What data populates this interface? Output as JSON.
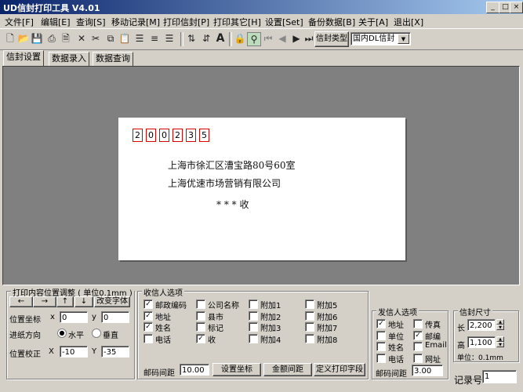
{
  "window": {
    "title": "UD信封打印工具 V4.01"
  },
  "menu": [
    "文件[F]",
    "编辑[E]",
    "查询[S]",
    "移动记录[M]",
    "打印信封[P]",
    "打印其它[H]",
    "设置[Set]",
    "备份数据[B]",
    "关于[A]",
    "退出[X]"
  ],
  "toolbar": {
    "type_button": "信封类型",
    "type_value": "国内DL信封"
  },
  "tabs": [
    "信封设置",
    "数据录入",
    "数据查询"
  ],
  "envelope": {
    "zip": [
      "2",
      "0",
      "0",
      "2",
      "3",
      "5"
    ],
    "address": "上海市徐汇区漕宝路80号60室",
    "company": "上海优速市场营销有限公司",
    "recipient": "* * *   收"
  },
  "position_panel": {
    "title": "打印内容位置调整 ( 单位0.1mm )",
    "arrows": [
      "←",
      "→",
      "↑",
      "↓"
    ],
    "change_font": "改变字体",
    "coord_label": "位置坐标",
    "x_label": "x",
    "x_value": "0",
    "y_label": "y",
    "y_value": "0",
    "direction_label": "进纸方向",
    "horizontal": "水平",
    "vertical": "垂直",
    "correction_label": "位置校正",
    "cx_label": "X",
    "cx_value": "-10",
    "cy_label": "Y",
    "cy_value": "-35"
  },
  "recipient_panel": {
    "title": "收信人选项",
    "options": [
      {
        "label": "邮政编码",
        "checked": true
      },
      {
        "label": "公司名称",
        "checked": false
      },
      {
        "label": "附加1",
        "checked": false
      },
      {
        "label": "附加5",
        "checked": false
      },
      {
        "label": "地址",
        "checked": true
      },
      {
        "label": "县市",
        "checked": false
      },
      {
        "label": "附加2",
        "checked": false
      },
      {
        "label": "附加6",
        "checked": false
      },
      {
        "label": "姓名",
        "checked": true
      },
      {
        "label": "标记",
        "checked": false
      },
      {
        "label": "附加3",
        "checked": false
      },
      {
        "label": "附加7",
        "checked": false
      },
      {
        "label": "电话",
        "checked": false
      },
      {
        "label": "收",
        "checked": true
      },
      {
        "label": "附加4",
        "checked": false
      },
      {
        "label": "附加8",
        "checked": false
      }
    ],
    "spacing_label": "邮码间距",
    "spacing_value": "10.00",
    "btn_set_coord": "设置坐标",
    "btn_amount": "金额间距",
    "btn_custom": "定义打印字段"
  },
  "sender_panel": {
    "title": "发信人选项",
    "options": [
      {
        "label": "地址",
        "checked": true
      },
      {
        "label": "传真",
        "checked": false
      },
      {
        "label": "单位",
        "checked": false
      },
      {
        "label": "邮编",
        "checked": true
      },
      {
        "label": "姓名",
        "checked": false
      },
      {
        "label": "Email",
        "checked": false
      },
      {
        "label": "电话",
        "checked": false
      },
      {
        "label": "网址",
        "checked": false
      }
    ],
    "spacing_label": "邮码间距",
    "spacing_value": "3.00"
  },
  "size_panel": {
    "title": "信封尺寸",
    "length_label": "长",
    "length_value": "2,200",
    "height_label": "高",
    "height_value": "1,100",
    "unit": "单位：0.1mm"
  },
  "record": {
    "label": "记录号",
    "value": "1"
  }
}
